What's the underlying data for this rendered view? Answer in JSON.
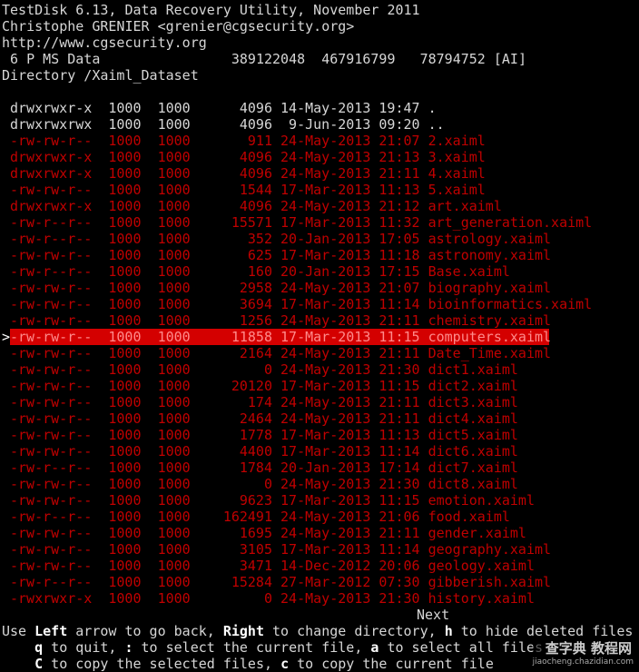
{
  "header": {
    "line1": "TestDisk 6.13, Data Recovery Utility, November 2011",
    "line2": "Christophe GRENIER <grenier@cgsecurity.org>",
    "line3": "http://www.cgsecurity.org",
    "line4": " 6 P MS Data                389122048  467916799   78794752 [AI]",
    "line5": "Directory /Xaiml_Dataset"
  },
  "files": [
    {
      "perm": "drwxrwxr-x",
      "uid": "1000",
      "gid": "1000",
      "size": "4096",
      "date": "14-May-2013",
      "time": "19:47",
      "name": ".",
      "deleted": false
    },
    {
      "perm": "drwxrwxrwx",
      "uid": "1000",
      "gid": "1000",
      "size": "4096",
      "date": " 9-Jun-2013",
      "time": "09:20",
      "name": "..",
      "deleted": false
    },
    {
      "perm": "-rw-rw-r--",
      "uid": "1000",
      "gid": "1000",
      "size": "911",
      "date": "24-May-2013",
      "time": "21:07",
      "name": "2.xaiml",
      "deleted": true
    },
    {
      "perm": "drwxrwxr-x",
      "uid": "1000",
      "gid": "1000",
      "size": "4096",
      "date": "24-May-2013",
      "time": "21:13",
      "name": "3.xaiml",
      "deleted": true
    },
    {
      "perm": "drwxrwxr-x",
      "uid": "1000",
      "gid": "1000",
      "size": "4096",
      "date": "24-May-2013",
      "time": "21:11",
      "name": "4.xaiml",
      "deleted": true
    },
    {
      "perm": "-rw-rw-r--",
      "uid": "1000",
      "gid": "1000",
      "size": "1544",
      "date": "17-Mar-2013",
      "time": "11:13",
      "name": "5.xaiml",
      "deleted": true
    },
    {
      "perm": "drwxrwxr-x",
      "uid": "1000",
      "gid": "1000",
      "size": "4096",
      "date": "24-May-2013",
      "time": "21:12",
      "name": "art.xaiml",
      "deleted": true
    },
    {
      "perm": "-rw-r--r--",
      "uid": "1000",
      "gid": "1000",
      "size": "15571",
      "date": "17-Mar-2013",
      "time": "11:32",
      "name": "art_generation.xaiml",
      "deleted": true
    },
    {
      "perm": "-rw-r--r--",
      "uid": "1000",
      "gid": "1000",
      "size": "352",
      "date": "20-Jan-2013",
      "time": "17:05",
      "name": "astrology.xaiml",
      "deleted": true
    },
    {
      "perm": "-rw-rw-r--",
      "uid": "1000",
      "gid": "1000",
      "size": "625",
      "date": "17-Mar-2013",
      "time": "11:18",
      "name": "astronomy.xaiml",
      "deleted": true
    },
    {
      "perm": "-rw-r--r--",
      "uid": "1000",
      "gid": "1000",
      "size": "160",
      "date": "20-Jan-2013",
      "time": "17:15",
      "name": "Base.xaiml",
      "deleted": true
    },
    {
      "perm": "-rw-rw-r--",
      "uid": "1000",
      "gid": "1000",
      "size": "2958",
      "date": "24-May-2013",
      "time": "21:07",
      "name": "biography.xaiml",
      "deleted": true
    },
    {
      "perm": "-rw-rw-r--",
      "uid": "1000",
      "gid": "1000",
      "size": "3694",
      "date": "17-Mar-2013",
      "time": "11:14",
      "name": "bioinformatics.xaiml",
      "deleted": true
    },
    {
      "perm": "-rw-rw-r--",
      "uid": "1000",
      "gid": "1000",
      "size": "1256",
      "date": "24-May-2013",
      "time": "21:11",
      "name": "chemistry.xaiml",
      "deleted": true
    },
    {
      "perm": "-rw-rw-r--",
      "uid": "1000",
      "gid": "1000",
      "size": "11858",
      "date": "17-Mar-2013",
      "time": "11:15",
      "name": "computers.xaiml",
      "deleted": true,
      "selected": true
    },
    {
      "perm": "-rw-rw-r--",
      "uid": "1000",
      "gid": "1000",
      "size": "2164",
      "date": "24-May-2013",
      "time": "21:11",
      "name": "Date_Time.xaiml",
      "deleted": true
    },
    {
      "perm": "-rw-rw-r--",
      "uid": "1000",
      "gid": "1000",
      "size": "0",
      "date": "24-May-2013",
      "time": "21:30",
      "name": "dict1.xaiml",
      "deleted": true
    },
    {
      "perm": "-rw-rw-r--",
      "uid": "1000",
      "gid": "1000",
      "size": "20120",
      "date": "17-Mar-2013",
      "time": "11:15",
      "name": "dict2.xaiml",
      "deleted": true
    },
    {
      "perm": "-rw-rw-r--",
      "uid": "1000",
      "gid": "1000",
      "size": "174",
      "date": "24-May-2013",
      "time": "21:11",
      "name": "dict3.xaiml",
      "deleted": true
    },
    {
      "perm": "-rw-rw-r--",
      "uid": "1000",
      "gid": "1000",
      "size": "2464",
      "date": "24-May-2013",
      "time": "21:11",
      "name": "dict4.xaiml",
      "deleted": true
    },
    {
      "perm": "-rw-rw-r--",
      "uid": "1000",
      "gid": "1000",
      "size": "1778",
      "date": "17-Mar-2013",
      "time": "11:13",
      "name": "dict5.xaiml",
      "deleted": true
    },
    {
      "perm": "-rw-rw-r--",
      "uid": "1000",
      "gid": "1000",
      "size": "4400",
      "date": "17-Mar-2013",
      "time": "11:14",
      "name": "dict6.xaiml",
      "deleted": true
    },
    {
      "perm": "-rw-r--r--",
      "uid": "1000",
      "gid": "1000",
      "size": "1784",
      "date": "20-Jan-2013",
      "time": "17:14",
      "name": "dict7.xaiml",
      "deleted": true
    },
    {
      "perm": "-rw-rw-r--",
      "uid": "1000",
      "gid": "1000",
      "size": "0",
      "date": "24-May-2013",
      "time": "21:30",
      "name": "dict8.xaiml",
      "deleted": true
    },
    {
      "perm": "-rw-rw-r--",
      "uid": "1000",
      "gid": "1000",
      "size": "9623",
      "date": "17-Mar-2013",
      "time": "11:15",
      "name": "emotion.xaiml",
      "deleted": true
    },
    {
      "perm": "-rw-r--r--",
      "uid": "1000",
      "gid": "1000",
      "size": "162491",
      "date": "24-May-2013",
      "time": "21:06",
      "name": "food.xaiml",
      "deleted": true
    },
    {
      "perm": "-rw-rw-r--",
      "uid": "1000",
      "gid": "1000",
      "size": "1695",
      "date": "24-May-2013",
      "time": "21:11",
      "name": "gender.xaiml",
      "deleted": true
    },
    {
      "perm": "-rw-rw-r--",
      "uid": "1000",
      "gid": "1000",
      "size": "3105",
      "date": "17-Mar-2013",
      "time": "11:14",
      "name": "geography.xaiml",
      "deleted": true
    },
    {
      "perm": "-rw-rw-r--",
      "uid": "1000",
      "gid": "1000",
      "size": "3471",
      "date": "14-Dec-2012",
      "time": "20:06",
      "name": "geology.xaiml",
      "deleted": true
    },
    {
      "perm": "-rw-r--r--",
      "uid": "1000",
      "gid": "1000",
      "size": "15284",
      "date": "27-Mar-2012",
      "time": "07:30",
      "name": "gibberish.xaiml",
      "deleted": true
    },
    {
      "perm": "-rwxrwxr-x",
      "uid": "1000",
      "gid": "1000",
      "size": "0",
      "date": "24-May-2013",
      "time": "21:30",
      "name": "history.xaiml",
      "deleted": true
    }
  ],
  "cursor_marker": ">",
  "next_label": "Next",
  "help": {
    "l1_a": "Use ",
    "l1_k1": "Left",
    "l1_b": " arrow to go back, ",
    "l1_k2": "Right",
    "l1_c": " to change directory, ",
    "l1_k3": "h",
    "l1_d": " to hide deleted files",
    "l2_a": "    ",
    "l2_k1": "q",
    "l2_b": " to quit, ",
    "l2_k2": ":",
    "l2_c": " to select the current file, ",
    "l2_k3": "a",
    "l2_d": " to select all files",
    "l3_a": "    ",
    "l3_k1": "C",
    "l3_b": " to copy the selected files, ",
    "l3_k2": "c",
    "l3_c": " to copy the current file"
  },
  "watermark": {
    "main": "查字典 教程网",
    "sub": "jiaocheng.chazidian.com"
  },
  "colors": {
    "background": "#000000",
    "text": "#d6d6d6",
    "deleted": "#c00000",
    "selection": "#d40000"
  }
}
